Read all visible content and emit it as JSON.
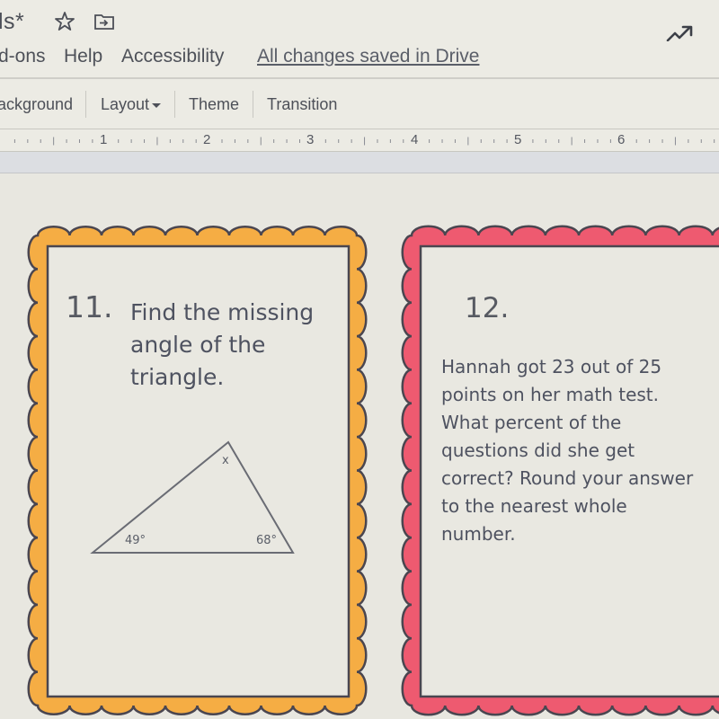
{
  "titlebar": {
    "doc_title": "ls*",
    "icons": [
      "star-icon",
      "move-to-folder-icon",
      "trending-up-icon"
    ]
  },
  "menubar": {
    "items": [
      "d-ons",
      "Help",
      "Accessibility"
    ],
    "save_status": "All changes saved in Drive"
  },
  "toolbar": {
    "background_label": "ackground",
    "layout_label": "Layout",
    "theme_label": "Theme",
    "transition_label": "Transition"
  },
  "ruler": {
    "labels": [
      "1",
      "2",
      "3",
      "4",
      "5",
      "6"
    ]
  },
  "slides": {
    "card11": {
      "number": "11.",
      "lines": [
        "Find the missing",
        "angle of the",
        "triangle."
      ],
      "border_color": "#f5ad44",
      "triangle": {
        "top_label": "x",
        "left_label": "49°",
        "right_label": "68°"
      }
    },
    "card12": {
      "number": "12.",
      "lines": [
        "Hannah got 23 out of 25",
        "points on her math test.",
        "What percent of the",
        "questions did she get",
        "correct? Round your answer",
        "to the nearest whole",
        "number."
      ],
      "border_color": "#ee5a70"
    }
  }
}
